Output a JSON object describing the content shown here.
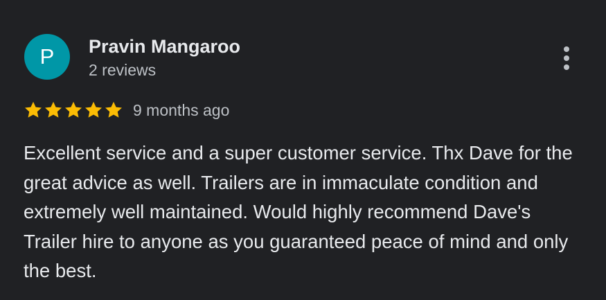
{
  "review": {
    "avatar_letter": "P",
    "avatar_color": "#0097a7",
    "reviewer_name": "Pravin Mangaroo",
    "review_count": "2 reviews",
    "rating": 5,
    "rating_max": 5,
    "star_color": "#fbbc04",
    "date": "9 months ago",
    "text": "Excellent service and a super customer service. Thx Dave for the great advice as well. Trailers are in immaculate condition and extremely well maintained. Would highly recommend Dave's Trailer hire to anyone as you guaranteed peace of mind and only the best.",
    "more_icon": "more-vert-icon"
  },
  "theme": {
    "background": "#202124",
    "primary_text": "#e8eaed",
    "secondary_text": "#bdc1c6"
  }
}
